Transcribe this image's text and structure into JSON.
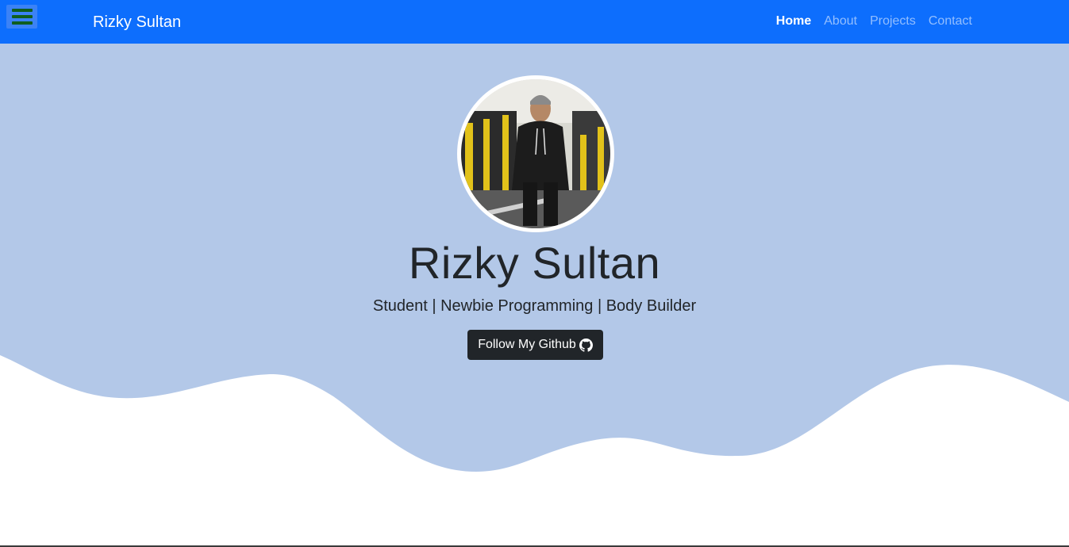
{
  "nav": {
    "brand": "Rizky Sultan",
    "links": [
      {
        "label": "Home",
        "active": true
      },
      {
        "label": "About",
        "active": false
      },
      {
        "label": "Projects",
        "active": false
      },
      {
        "label": "Contact",
        "active": false
      }
    ]
  },
  "hero": {
    "name": "Rizky Sultan",
    "tagline": "Student | Newbie Programming | Body Builder",
    "button_label": "Follow My Github"
  },
  "icons": {
    "menu": "hamburger-menu-icon",
    "github": "github-icon"
  },
  "colors": {
    "navbar": "#0d6efd",
    "hero_background": "#b3c8e8",
    "button": "#212529",
    "text": "#212529"
  }
}
